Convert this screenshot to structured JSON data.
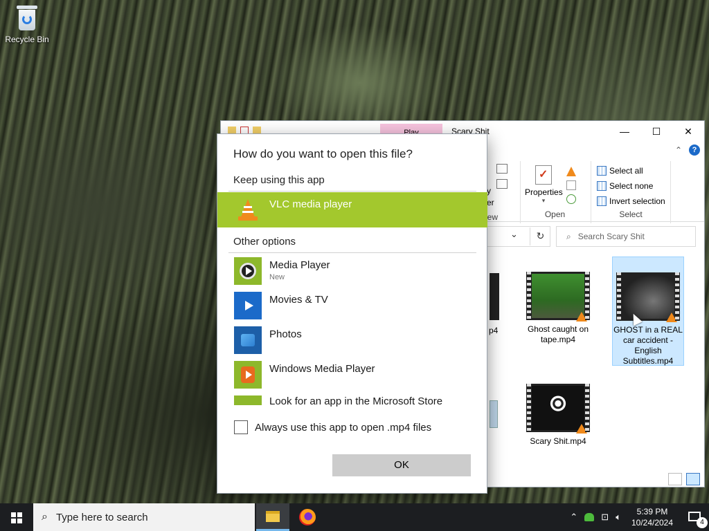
{
  "desktop": {
    "icons": [
      {
        "label": "Recycle Bin",
        "icon": "recycle-bin-icon"
      }
    ]
  },
  "explorer": {
    "title": "Scary Shit",
    "play_tab": "Play",
    "window_controls": {
      "minimize": "—",
      "maximize": "☐",
      "close": "✕"
    },
    "ribbon": {
      "partial_left_1": "y",
      "partial_left_2": "er",
      "view_label": "iew",
      "open_group_label": "Open",
      "properties_label": "Properties",
      "select_group_label": "Select",
      "select_all": "Select all",
      "select_none": "Select none",
      "invert_selection": "Invert selection"
    },
    "search_placeholder": "Search Scary Shit",
    "files": [
      {
        "name": "Ghost caught on tape.mp4",
        "selected": false
      },
      {
        "name": "GHOST in a REAL car accident - English Subtitles.mp4",
        "selected": true
      },
      {
        "name": "Scary Shit.mp4",
        "selected": false
      }
    ],
    "partial_file_label": "p4"
  },
  "dialog": {
    "title": "How do you want to open this file?",
    "keep_using_label": "Keep using this app",
    "current_app": {
      "name": "VLC media player",
      "icon": "vlc-icon",
      "highlight_color": "#a3c82d"
    },
    "other_options_label": "Other options",
    "options": [
      {
        "name": "Media Player",
        "sub": "New",
        "icon": "media-player-icon"
      },
      {
        "name": "Movies & TV",
        "sub": "",
        "icon": "movies-tv-icon"
      },
      {
        "name": "Photos",
        "sub": "",
        "icon": "photos-icon"
      },
      {
        "name": "Windows Media Player",
        "sub": "",
        "icon": "windows-media-player-icon"
      },
      {
        "name": "Look for an app in the Microsoft Store",
        "sub": "",
        "icon": "store-icon"
      }
    ],
    "always_use_label": "Always use this app to open .mp4 files",
    "always_use_checked": false,
    "ok_label": "OK"
  },
  "taskbar": {
    "search_placeholder": "Type here to search",
    "time": "5:39 PM",
    "date": "10/24/2024",
    "notification_count": "4"
  }
}
